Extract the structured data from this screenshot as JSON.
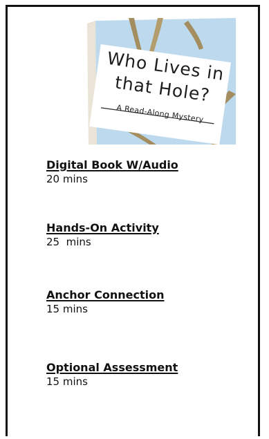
{
  "book": {
    "title": "Who Lives in\nthat Hole?",
    "subtitle": "A Read-Along Mystery"
  },
  "activities": [
    {
      "title": "Digital Book W/Audio",
      "time": "20 mins"
    },
    {
      "title": "Hands-On Activity",
      "time": "25  mins"
    },
    {
      "title": "Anchor Connection",
      "time": "15 mins"
    },
    {
      "title": "Optional Assessment",
      "time": "15 mins"
    }
  ],
  "colors": {
    "border": "#111111",
    "cover_sky": "#bcd9ee",
    "cover_branch": "#a48e60",
    "cover_label": "#ffffff"
  }
}
